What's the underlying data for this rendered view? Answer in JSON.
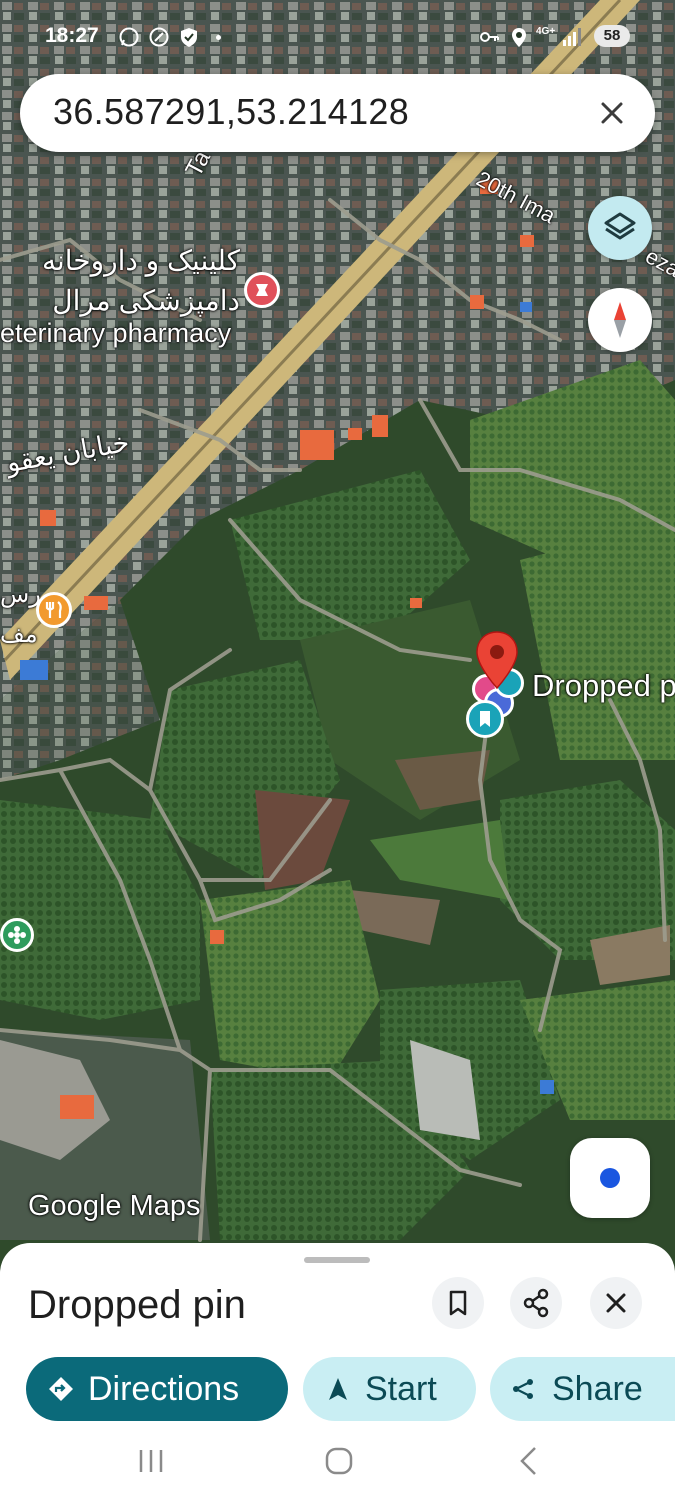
{
  "status_bar": {
    "time": "18:27",
    "battery": "58",
    "network": "4G+"
  },
  "search": {
    "query": "36.587291,53.214128"
  },
  "map_labels": {
    "road_en": "20th Ima",
    "road_en_suffix": "eza",
    "road_ta": "Ta",
    "clinic_fa_line1": "کلینیک و داروخانه",
    "clinic_fa_line2": "دامپزشکی مرال",
    "clinic_en": "eterinary pharmacy",
    "street_fa": "خیابان یعقو",
    "restaurant_fa_1": "رس",
    "restaurant_fa_2": "مف",
    "pin_label": "Dropped p",
    "watermark": "Google Maps"
  },
  "bottom_sheet": {
    "title": "Dropped pin",
    "actions": {
      "directions": "Directions",
      "start": "Start",
      "share": "Share"
    }
  },
  "colors": {
    "primary": "#0b6a7a",
    "chip_tonal": "#c9eef3",
    "pin_red": "#ea4335",
    "road_yellow": "#cdb77a"
  }
}
